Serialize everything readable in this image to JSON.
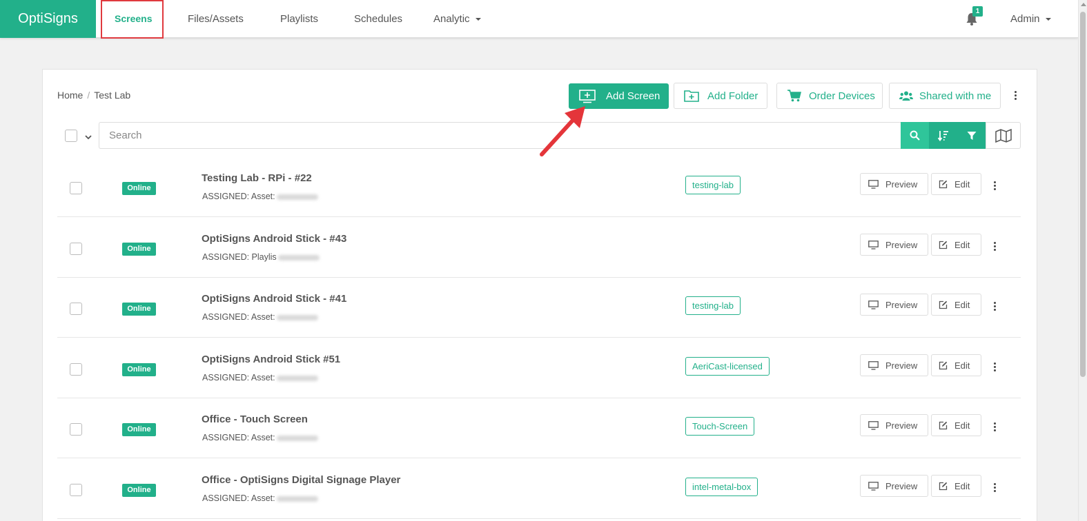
{
  "brand": "OptiSigns",
  "nav": {
    "screens": "Screens",
    "files": "Files/Assets",
    "playlists": "Playlists",
    "schedules": "Schedules",
    "analytic": "Analytic",
    "notifications_count": "1",
    "user": "Admin"
  },
  "breadcrumb": {
    "home": "Home",
    "separator": "/",
    "current": "Test Lab"
  },
  "toolbar": {
    "add_screen": "Add Screen",
    "add_folder": "Add Folder",
    "order_devices": "Order Devices",
    "shared": "Shared with me"
  },
  "search": {
    "placeholder": "Search"
  },
  "row_labels": {
    "preview": "Preview",
    "edit": "Edit"
  },
  "screens": [
    {
      "status": "Online",
      "name": "Testing Lab - RPi - #22",
      "assigned": "ASSIGNED: Asset:",
      "tag": "testing-lab"
    },
    {
      "status": "Online",
      "name": "OptiSigns Android Stick - #43",
      "assigned": "ASSIGNED: Playlis",
      "tag": ""
    },
    {
      "status": "Online",
      "name": "OptiSigns Android Stick - #41",
      "assigned": "ASSIGNED: Asset:",
      "tag": "testing-lab"
    },
    {
      "status": "Online",
      "name": "OptiSigns Android Stick #51",
      "assigned": "ASSIGNED: Asset:",
      "tag": "AeriCast-licensed"
    },
    {
      "status": "Online",
      "name": "Office - Touch Screen",
      "assigned": "ASSIGNED: Asset:",
      "tag": "Touch-Screen"
    },
    {
      "status": "Online",
      "name": "Office - OptiSigns Digital Signage Player",
      "assigned": "ASSIGNED: Asset:",
      "tag": "intel-metal-box"
    }
  ],
  "colors": {
    "accent": "#22b08a",
    "highlight": "#e0393e"
  }
}
